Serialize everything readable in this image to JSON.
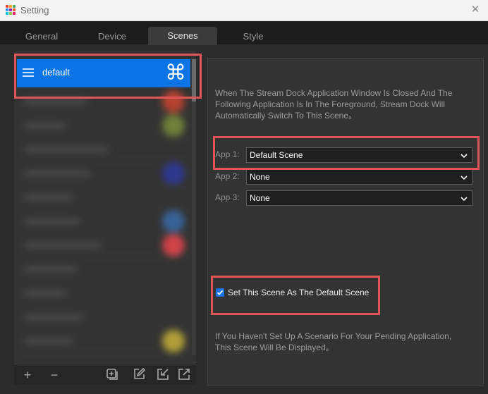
{
  "window": {
    "title": "Setting",
    "close_icon": "close-icon",
    "app_icon_colors": [
      "#e8463b",
      "#f5a623",
      "#4caf50",
      "#2196f3",
      "#9c27b0",
      "#ff5722",
      "#00bcd4",
      "#8bc34a",
      "#e91e63"
    ]
  },
  "tabs": [
    {
      "label": "General",
      "active": false
    },
    {
      "label": "Device",
      "active": false
    },
    {
      "label": "Scenes",
      "active": true
    },
    {
      "label": "Style",
      "active": false
    }
  ],
  "scenes": {
    "selected": {
      "label": "default",
      "icon": "command-icon",
      "highlight_color": "#0b74e6"
    },
    "toolbar": {
      "add": "+",
      "remove": "−",
      "icons": [
        "add-group-icon",
        "edit-icon",
        "import-icon",
        "export-icon"
      ]
    }
  },
  "settings": {
    "description": "When The Stream Dock Application Window Is Closed And The Following Application Is In The Foreground, Stream Dock Will Automatically Switch To This Scene。",
    "apps": [
      {
        "label": "App 1:",
        "value": "Default Scene"
      },
      {
        "label": "App 2:",
        "value": "None"
      },
      {
        "label": "App 3:",
        "value": "None"
      }
    ],
    "default_scene": {
      "label": "Set This Scene As The Default Scene",
      "checked": true
    },
    "footer": "If You Haven't Set Up A Scenario For Your Pending Application, This Scene Will Be Displayed。"
  },
  "colors": {
    "accent": "#0b74e6",
    "annotation": "#e05555"
  }
}
